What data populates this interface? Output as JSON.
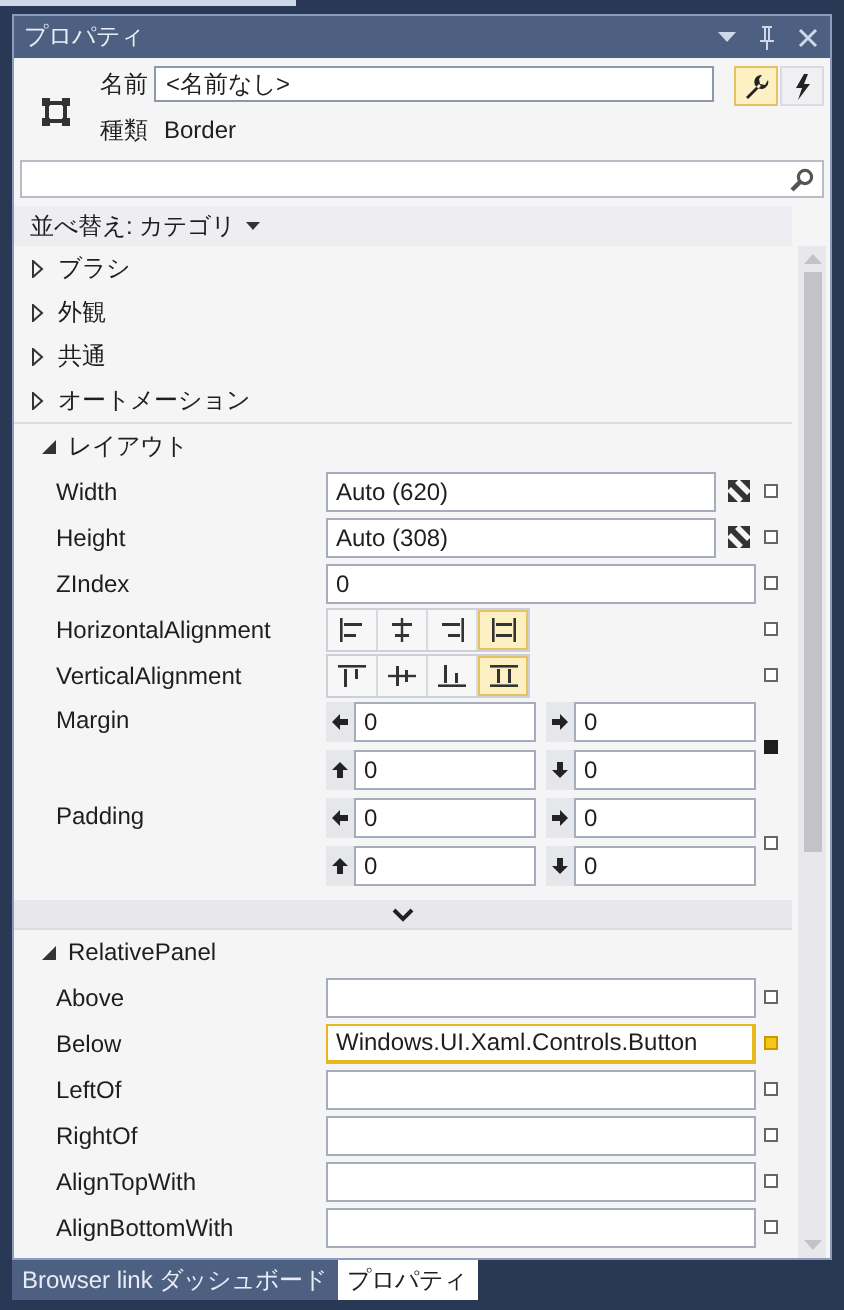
{
  "window": {
    "title": "プロパティ"
  },
  "header": {
    "name_label": "名前",
    "name_value": "<名前なし>",
    "type_label": "種類",
    "type_value": "Border",
    "modes": [
      {
        "kind": "properties",
        "selected": true
      },
      {
        "kind": "events",
        "selected": false
      }
    ]
  },
  "sort": {
    "label": "並べ替え: カテゴリ"
  },
  "categories": [
    {
      "label": "ブラシ",
      "expanded": false
    },
    {
      "label": "外観",
      "expanded": false
    },
    {
      "label": "共通",
      "expanded": false
    },
    {
      "label": "オートメーション",
      "expanded": false
    },
    {
      "label": "レイアウト",
      "expanded": true,
      "more": true,
      "properties": [
        {
          "kind": "text",
          "name": "Width",
          "value": "Auto (620)",
          "auto_size": true,
          "local_value": false,
          "resource_bound": false
        },
        {
          "kind": "text",
          "name": "Height",
          "value": "Auto (308)",
          "auto_size": true,
          "local_value": false,
          "resource_bound": false
        },
        {
          "kind": "text",
          "name": "ZIndex",
          "value": "0",
          "local_value": false,
          "resource_bound": false
        },
        {
          "kind": "halign",
          "name": "HorizontalAlignment",
          "local_value": false,
          "resource_bound": false,
          "options": [
            {
              "selected": false
            },
            {
              "selected": false
            },
            {
              "selected": false
            },
            {
              "selected": true
            }
          ]
        },
        {
          "kind": "valign",
          "name": "VerticalAlignment",
          "local_value": false,
          "resource_bound": false,
          "options": [
            {
              "selected": false
            },
            {
              "selected": false
            },
            {
              "selected": false
            },
            {
              "selected": true
            }
          ]
        },
        {
          "kind": "thickness",
          "name": "Margin",
          "values": [
            "0",
            "0",
            "0",
            "0"
          ],
          "local_value": true,
          "resource_bound": false
        },
        {
          "kind": "thickness",
          "name": "Padding",
          "values": [
            "0",
            "0",
            "0",
            "0"
          ],
          "local_value": false,
          "resource_bound": false
        }
      ]
    },
    {
      "label": "RelativePanel",
      "expanded": true,
      "properties": [
        {
          "kind": "text",
          "name": "Above",
          "local_value": false,
          "resource_bound": false
        },
        {
          "kind": "text",
          "name": "Below",
          "value": "Windows.UI.Xaml.Controls.Button",
          "local_value": false,
          "resource_bound": true
        },
        {
          "kind": "text",
          "name": "LeftOf",
          "local_value": false,
          "resource_bound": false
        },
        {
          "kind": "text",
          "name": "RightOf",
          "local_value": false,
          "resource_bound": false
        },
        {
          "kind": "text",
          "name": "AlignTopWith",
          "local_value": false,
          "resource_bound": false
        },
        {
          "kind": "text",
          "name": "AlignBottomWith",
          "local_value": false,
          "resource_bound": false
        }
      ]
    }
  ],
  "bottom_tabs": [
    {
      "label": "Browser link ダッシュボード",
      "selected": false
    },
    {
      "label": "プロパティ",
      "selected": true
    }
  ]
}
